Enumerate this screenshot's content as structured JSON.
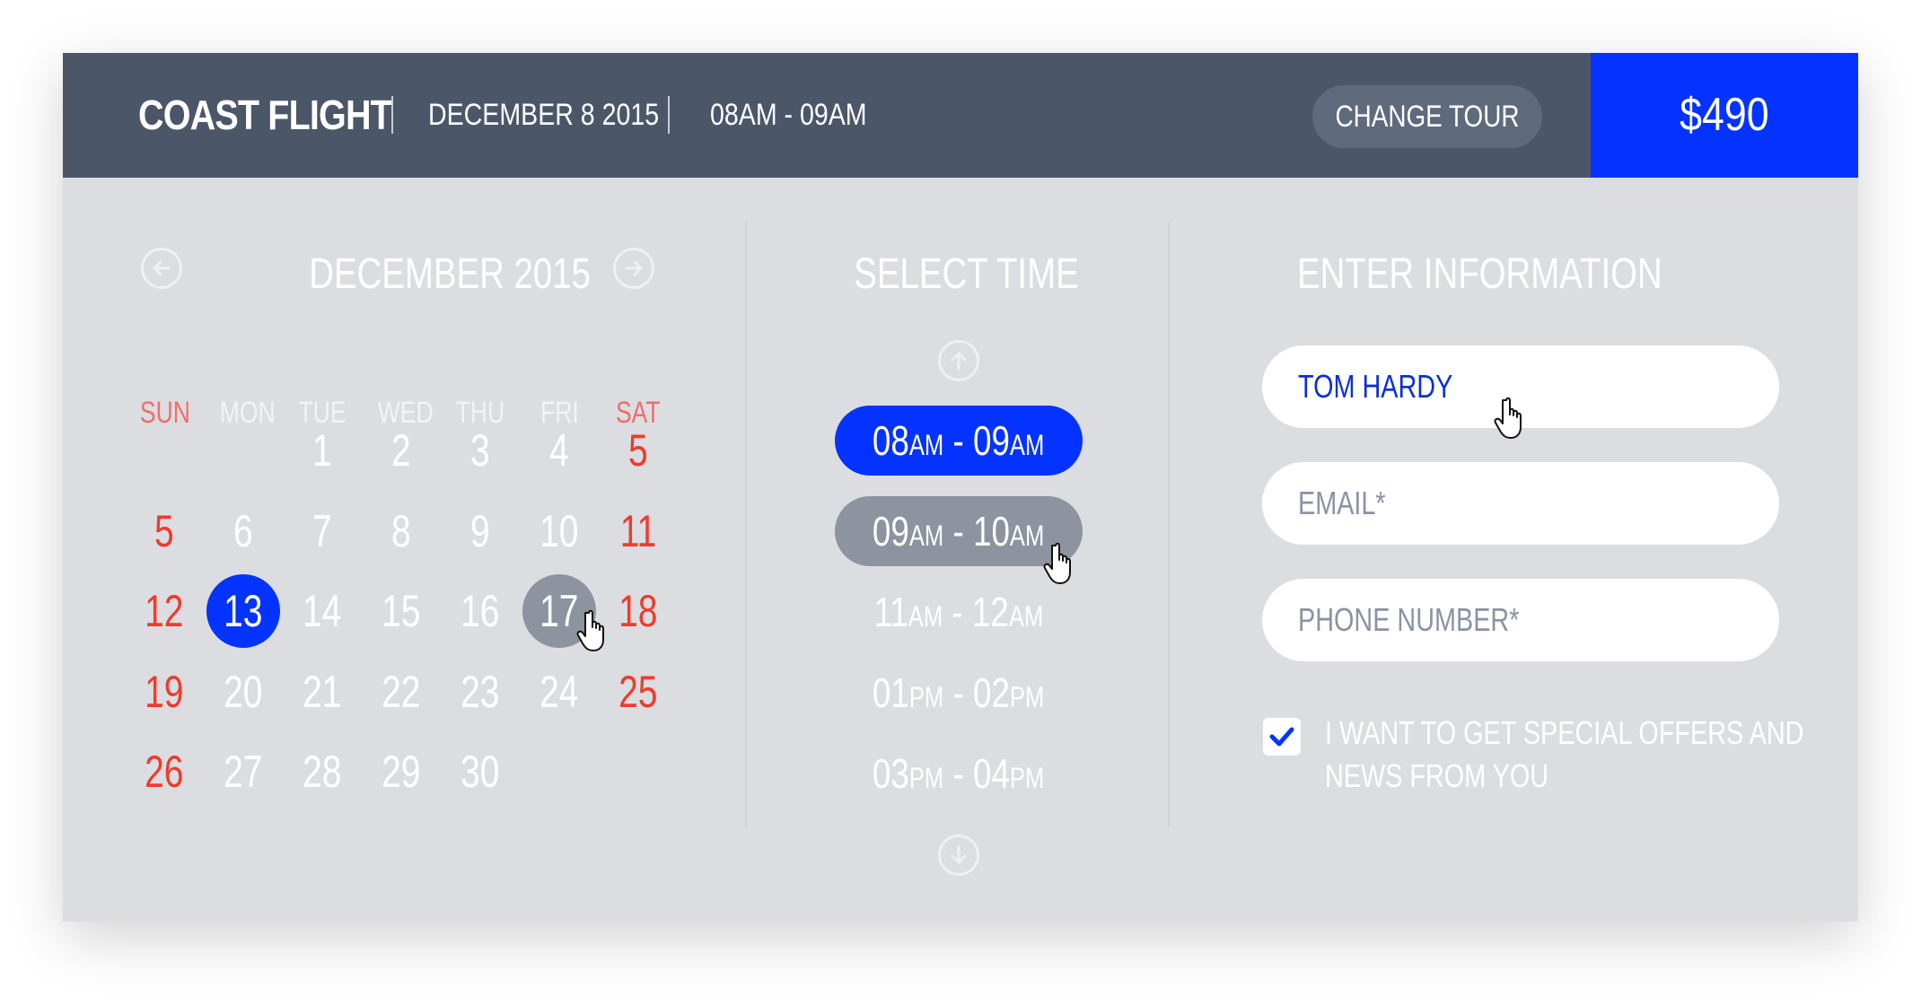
{
  "header": {
    "title": "COAST FLIGHT",
    "date": "DECEMBER 8 2015",
    "time": "08AM - 09AM",
    "change_label": "CHANGE TOUR",
    "price": "$490"
  },
  "calendar": {
    "title": "DECEMBER 2015",
    "prev_icon": "arrow-left-circle-icon",
    "next_icon": "arrow-right-circle-icon",
    "weekdays": [
      "SUN",
      "MON",
      "TUE",
      "WED",
      "THU",
      "FRI",
      "SAT"
    ],
    "weeks": [
      [
        "",
        "",
        "1",
        "2",
        "3",
        "4",
        "5"
      ],
      [
        "5",
        "6",
        "7",
        "8",
        "9",
        "10",
        "11"
      ],
      [
        "12",
        "13",
        "14",
        "15",
        "16",
        "17",
        "18"
      ],
      [
        "19",
        "20",
        "21",
        "22",
        "23",
        "24",
        "25"
      ],
      [
        "26",
        "27",
        "28",
        "29",
        "30",
        "",
        ""
      ]
    ],
    "selected_day": "13",
    "hovered_day": "17"
  },
  "time": {
    "title": "SELECT TIME",
    "up_icon": "arrow-up-circle-icon",
    "down_icon": "arrow-down-circle-icon",
    "slots": [
      {
        "s1": "08",
        "a1": "AM",
        "s2": "09",
        "a2": "AM",
        "state": "selected"
      },
      {
        "s1": "09",
        "a1": "AM",
        "s2": "10",
        "a2": "AM",
        "state": "hover"
      },
      {
        "s1": "11",
        "a1": "AM",
        "s2": "12",
        "a2": "AM",
        "state": ""
      },
      {
        "s1": "01",
        "a1": "PM",
        "s2": "02",
        "a2": "PM",
        "state": ""
      },
      {
        "s1": "03",
        "a1": "PM",
        "s2": "04",
        "a2": "PM",
        "state": ""
      }
    ]
  },
  "info": {
    "title": "ENTER INFORMATION",
    "name_value": "TOM HARDY",
    "email_placeholder": "EMAIL*",
    "phone_placeholder": "PHONE NUMBER*",
    "offers_checked": true,
    "offers_label_line1": "I WANT TO GET SPECIAL OFFERS AND",
    "offers_label_line2": "NEWS FROM YOU"
  },
  "colors": {
    "header_bg": "#4b5669",
    "accent": "#0433ff",
    "panel_bg": "#dcdde1",
    "weekend": "#ef3b2d",
    "hover": "#8d939f"
  }
}
